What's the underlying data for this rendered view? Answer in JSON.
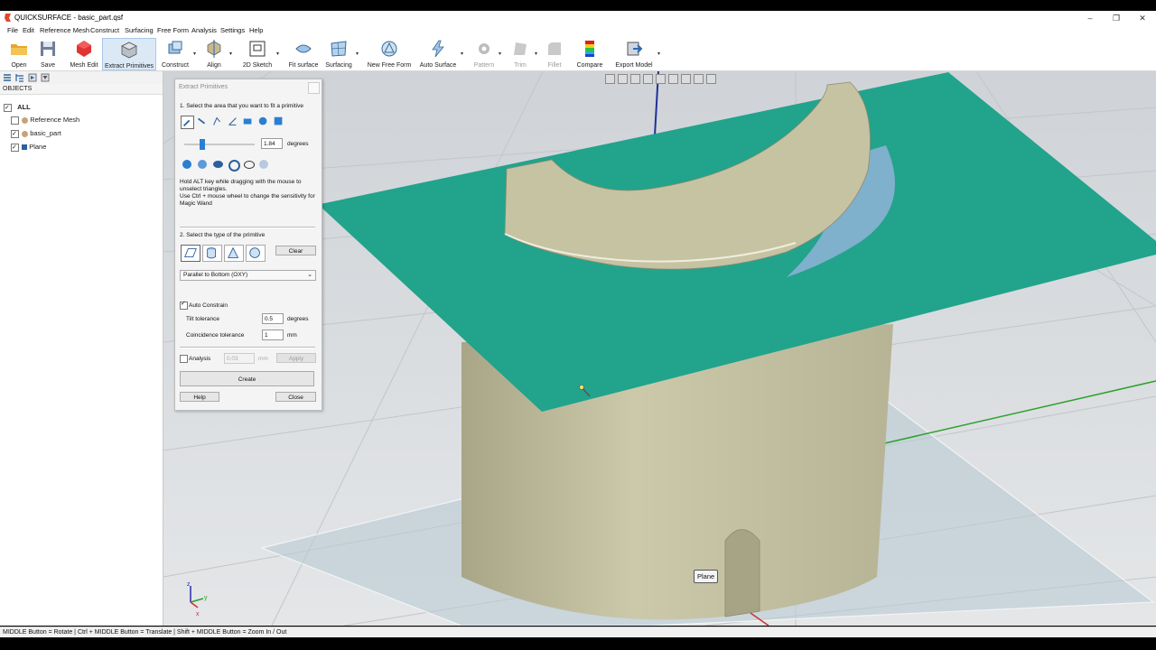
{
  "window": {
    "title": "QUICKSURFACE - basic_part.qsf",
    "minimize": "–",
    "restore": "❐",
    "close": "✕"
  },
  "menu": [
    "File",
    "Edit",
    "Reference Mesh",
    "Construct",
    "Surfacing",
    "Free Form",
    "Analysis",
    "Settings",
    "Help"
  ],
  "toolbar": {
    "open": "Open",
    "save": "Save",
    "mesh_edit": "Mesh Edit",
    "extract_primitives": "Extract Primitives",
    "construct": "Construct",
    "align": "Align",
    "sketch_2d": "2D Sketch",
    "fit_surface": "Fit surface",
    "surfacing": "Surfacing",
    "new_free_form": "New Free Form",
    "auto_surface": "Auto Surface",
    "pattern": "Pattern",
    "trim": "Trim",
    "fillet": "Fillet",
    "compare": "Compare",
    "export_model": "Export Model"
  },
  "objects": {
    "header": "OBJECTS",
    "root": "ALL",
    "items": [
      "Reference Mesh",
      "basic_part",
      "Plane"
    ]
  },
  "dialog": {
    "title": "Extract Primitives",
    "step1": "1. Select the area that you want to fit a primitive",
    "angle_value": "1.84",
    "angle_unit": "degrees",
    "hint_line1": "Hold ALT key while dragging with the mouse to",
    "hint_line2": "unselect triangles.",
    "hint_line3": "Use Ctrl + mouse wheel to change the sensitivity for",
    "hint_line4": "Magic Wand",
    "step2": "2. Select the type of the primitive",
    "clear": "Clear",
    "orientation": "Parallel to Bottom (OXY)",
    "auto_constrain": "Auto Constrain",
    "tilt_label": "Tilt tolerance",
    "tilt_value": "0.5",
    "tilt_unit": "degrees",
    "coinc_label": "Coincidence tolerance",
    "coinc_value": "1",
    "coinc_unit": "mm",
    "analysis": "Analysis",
    "analysis_value": "0.03",
    "analysis_unit": "mm",
    "apply": "Apply",
    "create": "Create",
    "help": "Help",
    "close": "Close"
  },
  "viewport": {
    "plane_label": "Plane",
    "axis_x": "x",
    "axis_y": "y",
    "axis_z": "z"
  },
  "status": "MIDDLE Button = Rotate | Ctrl + MIDDLE Button = Translate | Shift + MIDDLE Button = Zoom In / Out",
  "colors": {
    "plane": "#22a38c",
    "part": "#c6c3a3",
    "highlight": "#7fb0cc",
    "viewport_bg": "#dcdfe2"
  }
}
